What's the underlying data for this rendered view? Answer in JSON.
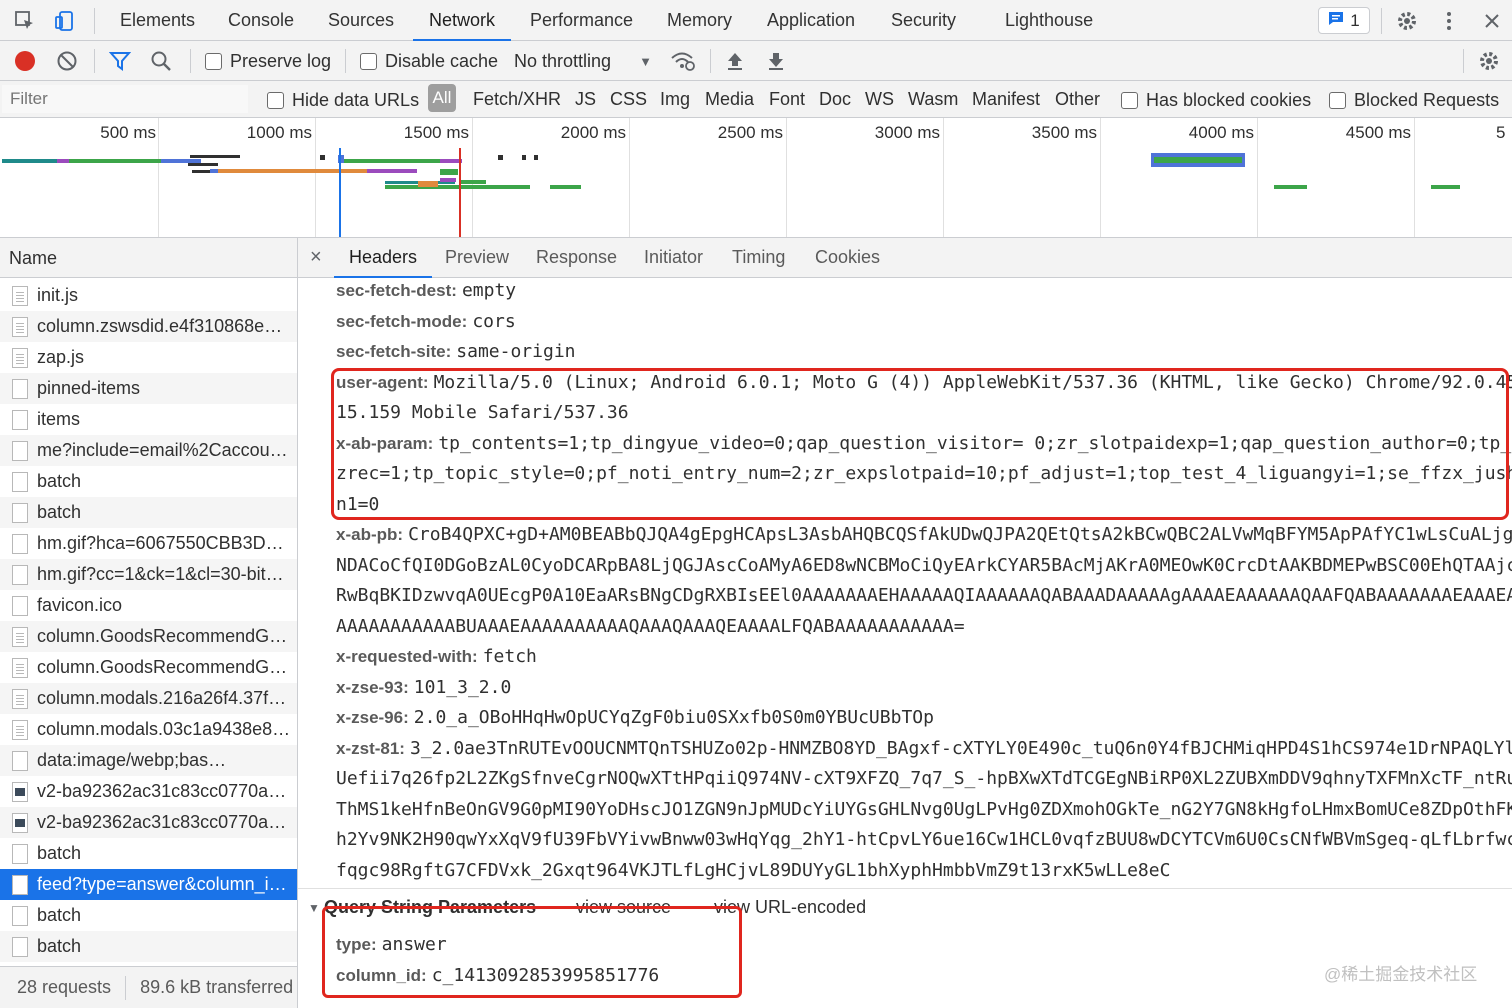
{
  "devtools_tabs": [
    "Elements",
    "Console",
    "Sources",
    "Network",
    "Performance",
    "Memory",
    "Application",
    "Security",
    "Lighthouse"
  ],
  "issues_count": "1",
  "toolbar": {
    "preserve_log": "Preserve log",
    "disable_cache": "Disable cache",
    "throttling": "No throttling"
  },
  "filter": {
    "placeholder": "Filter",
    "hide_data_urls": "Hide data URLs",
    "all": "All",
    "types": [
      "Fetch/XHR",
      "JS",
      "CSS",
      "Img",
      "Media",
      "Font",
      "Doc",
      "WS",
      "Wasm",
      "Manifest",
      "Other"
    ],
    "has_blocked_cookies": "Has blocked cookies",
    "blocked_requests": "Blocked Requests"
  },
  "timeline_ticks": [
    "500 ms",
    "1000 ms",
    "1500 ms",
    "2000 ms",
    "2500 ms",
    "3000 ms",
    "3500 ms",
    "4000 ms",
    "4500 ms",
    "5"
  ],
  "requests": {
    "header": "Name",
    "items": [
      {
        "name": "init.js",
        "icon": "doc"
      },
      {
        "name": "column.zswsdid.e4f310868e1…",
        "icon": "doc"
      },
      {
        "name": "zap.js",
        "icon": "doc"
      },
      {
        "name": "pinned-items",
        "icon": "blank"
      },
      {
        "name": "items",
        "icon": "blank"
      },
      {
        "name": "me?include=email%2Caccou…",
        "icon": "blank"
      },
      {
        "name": "batch",
        "icon": "blank"
      },
      {
        "name": "batch",
        "icon": "blank"
      },
      {
        "name": "hm.gif?hca=6067550CBB3D…",
        "icon": "blank"
      },
      {
        "name": "hm.gif?cc=1&ck=1&cl=30-bit…",
        "icon": "blank"
      },
      {
        "name": "favicon.ico",
        "icon": "blank"
      },
      {
        "name": "column.GoodsRecommendG…",
        "icon": "doc"
      },
      {
        "name": "column.GoodsRecommendG…",
        "icon": "doc"
      },
      {
        "name": "column.modals.216a26f4.37f…",
        "icon": "doc"
      },
      {
        "name": "column.modals.03c1a9438e8…",
        "icon": "doc"
      },
      {
        "name": "data:image/webp;bas…",
        "icon": "blank"
      },
      {
        "name": "v2-ba92362ac31c83cc0770a…",
        "icon": "img"
      },
      {
        "name": "v2-ba92362ac31c83cc0770a…",
        "icon": "img"
      },
      {
        "name": "batch",
        "icon": "blank"
      },
      {
        "name": "feed?type=answer&column_i…",
        "icon": "blank",
        "selected": true
      },
      {
        "name": "batch",
        "icon": "blank"
      },
      {
        "name": "batch",
        "icon": "blank"
      }
    ],
    "footer_requests": "28 requests",
    "footer_transferred": "89.6 kB transferred"
  },
  "detail_tabs": [
    "Headers",
    "Preview",
    "Response",
    "Initiator",
    "Timing",
    "Cookies"
  ],
  "headers": [
    {
      "key": "sec-fetch-dest:",
      "lines": [
        "empty"
      ]
    },
    {
      "key": "sec-fetch-mode:",
      "lines": [
        "cors"
      ]
    },
    {
      "key": "sec-fetch-site:",
      "lines": [
        "same-origin"
      ]
    },
    {
      "key": "user-agent:",
      "lines": [
        "Mozilla/5.0 (Linux; Android 6.0.1; Moto G (4)) AppleWebKit/537.36 (KHTML, like Gecko) Chrome/92.0.45",
        "15.159 Mobile Safari/537.36"
      ]
    },
    {
      "key": "x-ab-param:",
      "lines": [
        "tp_contents=1;tp_dingyue_video=0;qap_question_visitor= 0;zr_slotpaidexp=1;qap_question_author=0;tp_",
        "zrec=1;tp_topic_style=0;pf_noti_entry_num=2;zr_expslotpaid=10;pf_adjust=1;top_test_4_liguangyi=1;se_ffzx_jushe",
        "n1=0"
      ]
    },
    {
      "key": "x-ab-pb:",
      "lines": [
        "CroB4QPXC+gD+AM0BEABbQJQA4gEpgHCApsL3AsbAHQBCQSfAkUDwQJPA2QEtQtsA2kBCwQBC2ALVwMqBFYM5ApPAfYC1wLsCuALjg",
        "NDACoCfQI0DGoBzAL0CyoDCARpBA8LjQGJAscCoAMyA6ED8wNCBMoCiQyEArkCYAR5BAcMjAKrA0MEOwK0CrcDtAAKBDMEPwBSC00EhQTAAjcM",
        "RwBqBKIDzwvqA0UEcgP0A10EaARsBNgCDgRXBIsEEl0AAAAAAAEHAAAAAQIAAAAAAQABAAADAAAAAgAAAAEAAAAAAQAAFQABAAAAAAAEAAAEABA",
        "AAAAAAAAAAABUAAAEAAAAAAAAAAQAAAQAAAQEAAAALFQABAAAAAAAAAAA="
      ]
    },
    {
      "key": "x-requested-with:",
      "lines": [
        "fetch"
      ]
    },
    {
      "key": "x-zse-93:",
      "lines": [
        "101_3_2.0"
      ]
    },
    {
      "key": "x-zse-96:",
      "lines": [
        "2.0_a_OBoHHqHwOpUCYqZgF0biu0SXxfb0S0m0YBUcUBbTOp"
      ]
    },
    {
      "key": "x-zst-81:",
      "lines": [
        "3_2.0ae3TnRUTEvOOUCNMTQnTSHUZo02p-HNMZBO8YD_BAgxf-cXTYLY0E490c_tuQ6n0Y4fBJCHMiqHPD4S1hCS974e1DrNPAQLYl",
        "Uefii7q26fp2L2ZKgSfnveCgrNOQwXTtHPqiiQ974NV-cXT9XFZQ_7q7_S_-hpBXwXTdTCGEgNBiRP0XL2ZUBXmDDV9qhnyTXFMnXcTF_ntRue",
        "ThMS1keHfnBeOnGV9G0pMI90YoDHscJO1ZGN9nJpMUDcYiUYGsGHLNvg0UgLPvHg0ZDXmohOGkTe_nG2Y7GN8kHgfoLHmxBomUCe8ZDpOthFKy",
        "h2Yv9NK2H90qwYxXqV9fU39FbVYivwBnww03wHqYqg_2hY1-htCpvLY6ue16Cw1HCL0vqfzBUU8wDCYTCVm6U0CsCNfWBVmSgeq-qLfLbrfwce",
        "fqgc98RgftG7CFDVxk_2Gxqt964VKJTLfLgHCjvL89DUYyGL1bhXyphHmbbVmZ9t13rxK5wLLe8eC"
      ]
    }
  ],
  "query_string": {
    "title": "Query String Parameters",
    "view_source": "view source",
    "view_url_encoded": "view URL-encoded",
    "params": [
      {
        "key": "type:",
        "value": "answer"
      },
      {
        "key": "column_id:",
        "value": "c_1413092853995851776"
      }
    ]
  },
  "watermark": "@稀土掘金技术社区",
  "colors": {
    "accent": "#1a73e8",
    "highlight": "#e0261e",
    "record": "#d93025"
  }
}
